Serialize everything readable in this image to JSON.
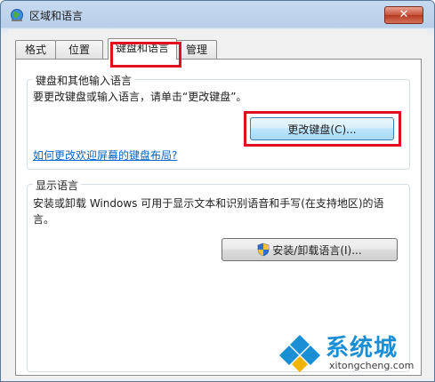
{
  "window": {
    "title": "区域和语言",
    "close_label": "✕"
  },
  "tabs": [
    {
      "label": "格式",
      "active": false
    },
    {
      "label": "位置",
      "active": false
    },
    {
      "label": "键盘和语言",
      "active": true
    },
    {
      "label": "管理",
      "active": false
    }
  ],
  "keyboard_group": {
    "title": "键盘和其他输入语言",
    "description": "要更改键盘或输入语言，请单击“更改键盘”。",
    "button_label": "更改键盘(C)...",
    "link_text": "如何更改欢迎屏幕的键盘布局?"
  },
  "display_group": {
    "title": "显示语言",
    "description": "安装或卸载 Windows 可用于显示文本和识别语音和手写(在支持地区)的语言。",
    "button_label": "安装/卸载语言(I)..."
  },
  "watermark": {
    "name": "系统城",
    "url": "xitongcheng.com"
  },
  "colors": {
    "highlight": "#e01020",
    "link": "#0066cc",
    "watermark": "#1a8fd6"
  }
}
